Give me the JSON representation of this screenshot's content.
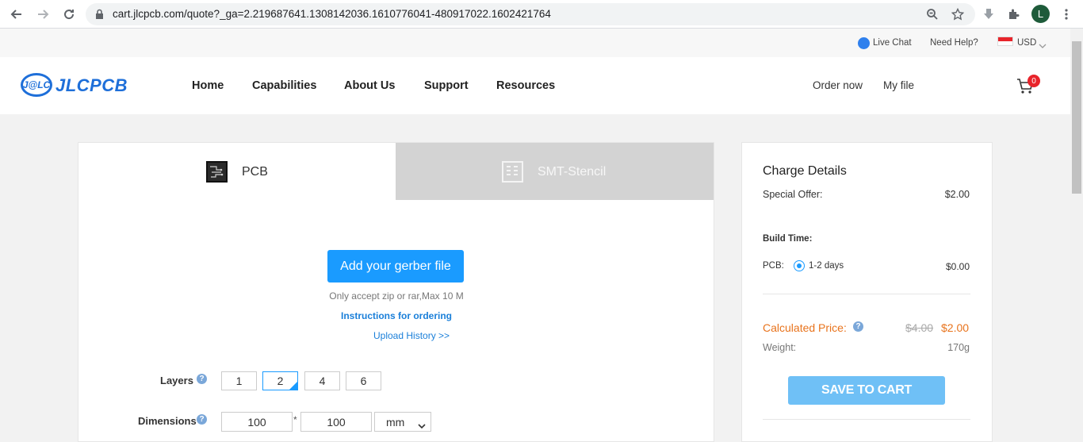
{
  "browser": {
    "url": "cart.jlcpcb.com/quote?_ga=2.219687641.1308142036.1610776041-480917022.1602421764",
    "profile_initial": "L"
  },
  "utility_bar": {
    "live_chat": "Live Chat",
    "need_help": "Need Help?",
    "currency": "USD"
  },
  "header": {
    "logo_mark": "J@LC",
    "logo_text": "JLCPCB",
    "menu": [
      "Home",
      "Capabilities",
      "About Us",
      "Support",
      "Resources"
    ],
    "order_now": "Order now",
    "my_file": "My file",
    "cart_count": "0"
  },
  "quote": {
    "tabs": [
      {
        "label": "PCB",
        "active": true
      },
      {
        "label": "SMT-Stencil",
        "active": false
      }
    ],
    "add_gerber": "Add your gerber file",
    "accept_hint": "Only accept zip or rar,Max 10 M",
    "instructions": "Instructions for ordering",
    "upload_history": "Upload History >>",
    "layers_label": "Layers",
    "layers": [
      "1",
      "2",
      "4",
      "6"
    ],
    "layers_selected": "2",
    "dimensions_label": "Dimensions",
    "dim_x": "100",
    "dim_sep": "*",
    "dim_y": "100",
    "dim_unit": "mm"
  },
  "charge": {
    "title": "Charge Details",
    "special_offer_label": "Special Offer:",
    "special_offer_value": "$2.00",
    "build_time_label": "Build Time:",
    "pcb_label": "PCB:",
    "build_option": "1-2 days",
    "build_price": "$0.00",
    "calculated_label": "Calculated Price:",
    "old_price": "$4.00",
    "new_price": "$2.00",
    "weight_label": "Weight:",
    "weight_value": "170g",
    "save_button": "SAVE TO CART"
  },
  "colors": {
    "brand_blue": "#1e6fd9",
    "accent_blue": "#1a9bff",
    "price_orange": "#e8731c",
    "badge_red": "#e8242b"
  }
}
